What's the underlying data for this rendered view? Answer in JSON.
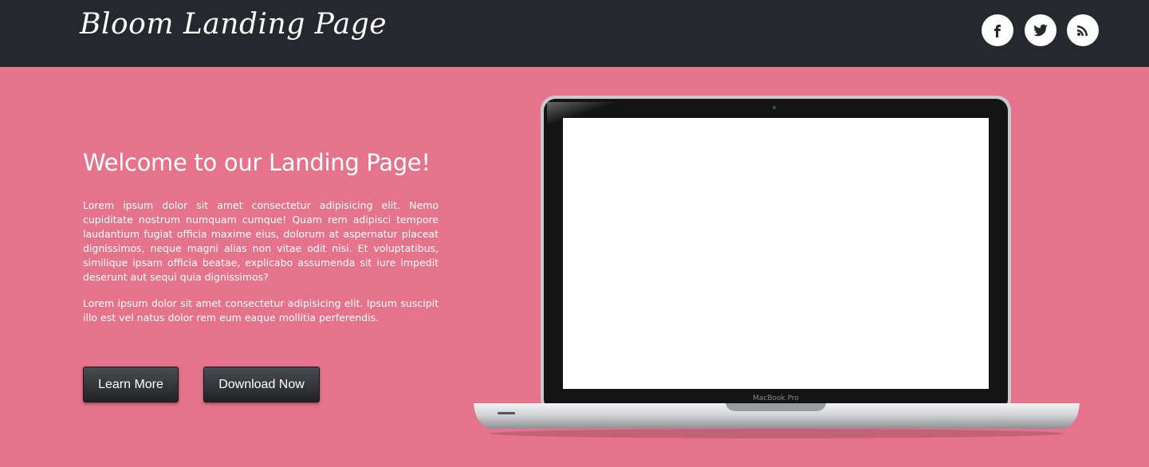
{
  "header": {
    "brand": "Bloom Landing Page",
    "social": [
      {
        "name": "facebook-icon",
        "label": "Facebook"
      },
      {
        "name": "twitter-icon",
        "label": "Twitter"
      },
      {
        "name": "rss-icon",
        "label": "RSS"
      }
    ],
    "bg_color": "#25282d"
  },
  "hero": {
    "bg_color": "#e5738b",
    "headline": "Welcome to our Landing Page!",
    "paragraph1": "Lorem ipsum dolor sit amet consectetur adipisicing elit. Nemo cupiditate nostrum numquam cumque! Quam rem adipisci tempore laudantium fugiat officia maxime eius, dolorum at aspernatur placeat dignissimos, neque magni alias non vitae odit nisi. Et voluptatibus, similique ipsam officia beatae, explicabo assumenda sit iure impedit deserunt aut sequi quia dignissimos?",
    "paragraph2": "Lorem ipsum dolor sit amet consectetur adipisicing elit. Ipsum suscipit illo est vel natus dolor rem eum eaque mollitia perferendis.",
    "buttons": {
      "learn_more": "Learn More",
      "download_now": "Download Now"
    },
    "laptop_label": "MacBook Pro"
  }
}
